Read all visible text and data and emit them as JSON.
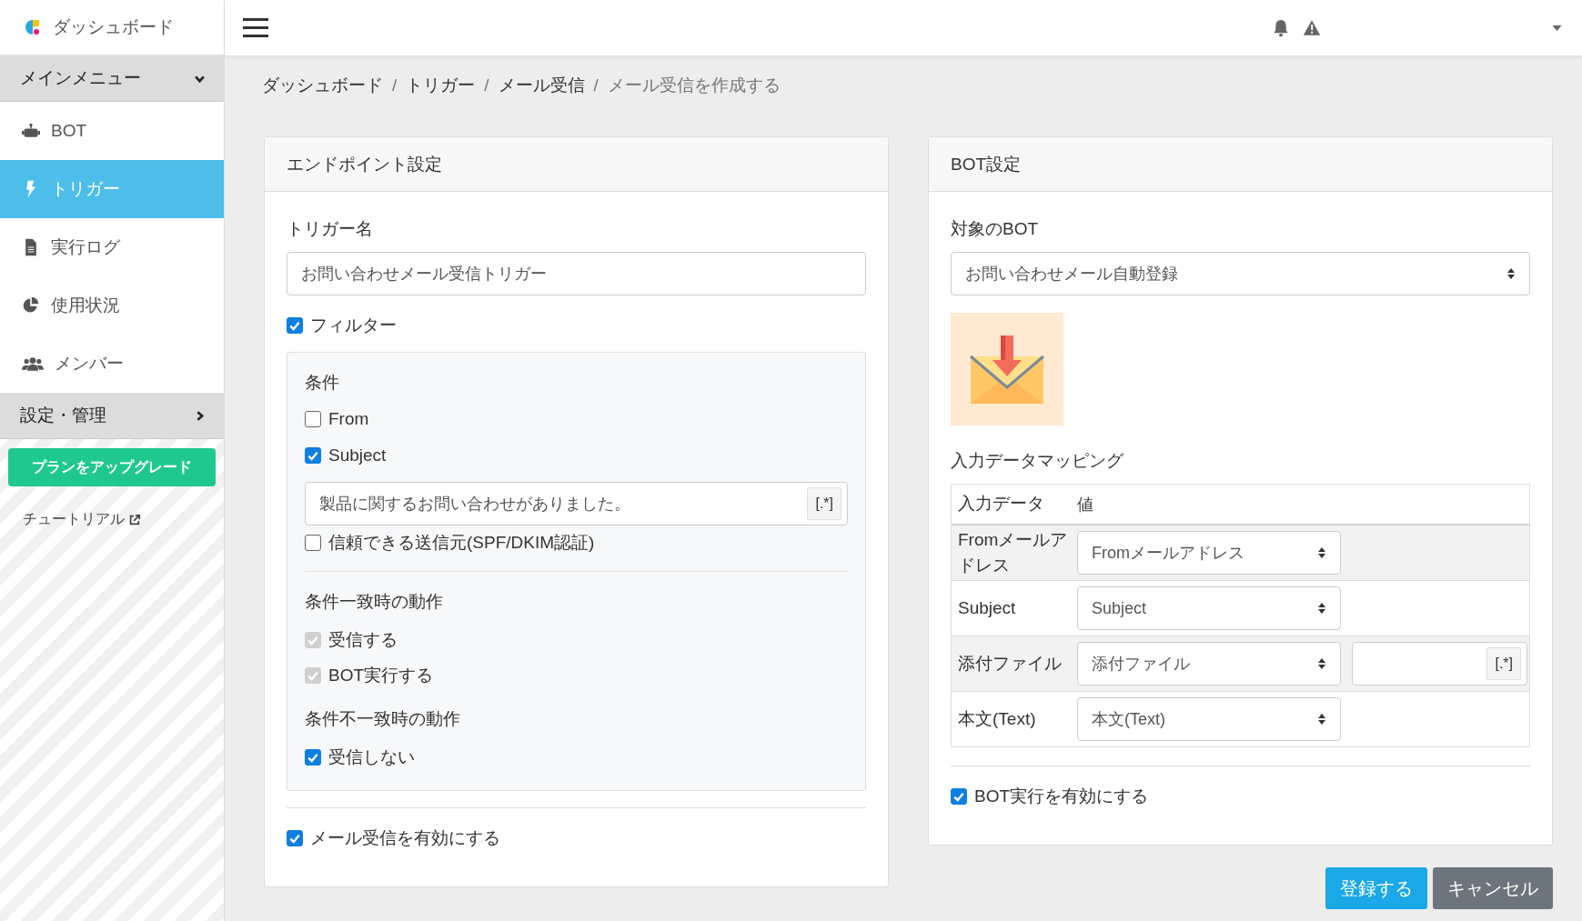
{
  "sidebar": {
    "brand": "ダッシュボード",
    "sections": [
      {
        "label": "メインメニュー",
        "expanded": true,
        "items": [
          {
            "label": "BOT",
            "selected": false
          },
          {
            "label": "トリガー",
            "selected": true
          },
          {
            "label": "実行ログ",
            "selected": false
          },
          {
            "label": "使用状況",
            "selected": false
          },
          {
            "label": "メンバー",
            "selected": false
          }
        ]
      },
      {
        "label": "設定・管理",
        "expanded": false
      }
    ],
    "upgrade_button": "プランをアップグレード",
    "tutorial_link": "チュートリアル"
  },
  "breadcrumb": [
    {
      "label": "ダッシュボード"
    },
    {
      "separator": "/",
      "label": "トリガー"
    },
    {
      "separator": "/",
      "label": "メール受信"
    },
    {
      "separator": "/",
      "label": "メール受信を作成する"
    }
  ],
  "endpoint_card": {
    "title": "エンドポイント設定",
    "trigger_name_label": "トリガー名",
    "trigger_name_value": "お問い合わせメール受信トリガー",
    "filter": {
      "label": "フィルター",
      "checked": true
    },
    "conditions": {
      "title": "条件",
      "items": [
        {
          "kind": "checkbox",
          "label": "From",
          "checked": false
        },
        {
          "kind": "checkbox",
          "label": "Subject",
          "checked": true
        },
        {
          "kind": "input",
          "value": "製品に関するお問い合わせがありました。",
          "regex_button": "[.*]"
        },
        {
          "kind": "checkbox",
          "label": "信頼できる送信元(SPF/DKIM認証)",
          "checked": false
        }
      ]
    },
    "match_actions": {
      "title": "条件一致時の動作",
      "items": [
        {
          "label": "受信する",
          "checked": true,
          "disabled": true
        },
        {
          "label": "BOT実行する",
          "checked": true,
          "disabled": true
        }
      ]
    },
    "mismatch_actions": {
      "title": "条件不一致時の動作",
      "items": [
        {
          "label": "受信しない",
          "checked": true,
          "disabled": false
        }
      ]
    },
    "enable": {
      "label": "メール受信を有効にする",
      "checked": true
    }
  },
  "bot_card": {
    "title": "BOT設定",
    "target_label": "対象のBOT",
    "target_value": "お問い合わせメール自動登録",
    "mapping_title": "入力データマッピング",
    "columns": [
      "入力データ",
      "値"
    ],
    "rows": [
      {
        "name": "Fromメールアドレス",
        "value": "Fromメールアドレス"
      },
      {
        "name": "Subject",
        "value": "Subject"
      },
      {
        "name": "添付ファイル",
        "value": "添付ファイル",
        "regex_button": "[.*]"
      },
      {
        "name": "本文(Text)",
        "value": "本文(Text)"
      }
    ],
    "enable": {
      "label": "BOT実行を有効にする",
      "checked": true
    }
  },
  "buttons": [
    {
      "label": "登録する",
      "kind": "primary"
    },
    {
      "label": "キャンセル",
      "kind": "secondary"
    }
  ]
}
